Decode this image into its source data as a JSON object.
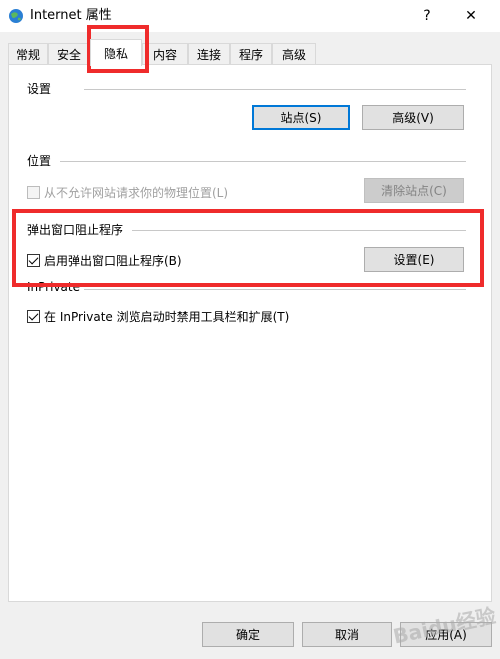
{
  "window": {
    "title": "Internet 属性",
    "help_glyph": "?",
    "close_glyph": "✕"
  },
  "tabs": [
    {
      "label": "常规",
      "active": false
    },
    {
      "label": "安全",
      "active": false
    },
    {
      "label": "隐私",
      "active": true
    },
    {
      "label": "内容",
      "active": false
    },
    {
      "label": "连接",
      "active": false
    },
    {
      "label": "程序",
      "active": false
    },
    {
      "label": "高级",
      "active": false
    }
  ],
  "settings_group": {
    "label": "设置",
    "sites_button": "站点(S)",
    "advanced_button": "高级(V)"
  },
  "location_group": {
    "label": "位置",
    "checkbox_label": "从不允许网站请求你的物理位置(L)",
    "checked": false,
    "clear_button": "清除站点(C)"
  },
  "popup_group": {
    "label": "弹出窗口阻止程序",
    "checkbox_label": "启用弹出窗口阻止程序(B)",
    "checked": true,
    "settings_button": "设置(E)"
  },
  "inprivate_group": {
    "label": "InPrivate",
    "checkbox_label": "在 InPrivate 浏览启动时禁用工具栏和扩展(T)",
    "checked": true
  },
  "footer": {
    "ok_button": "确定",
    "cancel_button": "取消",
    "apply_button": "应用(A)"
  },
  "watermark_text": "Baidu经验",
  "colors": {
    "annotation_red": "#ef2b2b",
    "default_button_border": "#0078d7"
  }
}
